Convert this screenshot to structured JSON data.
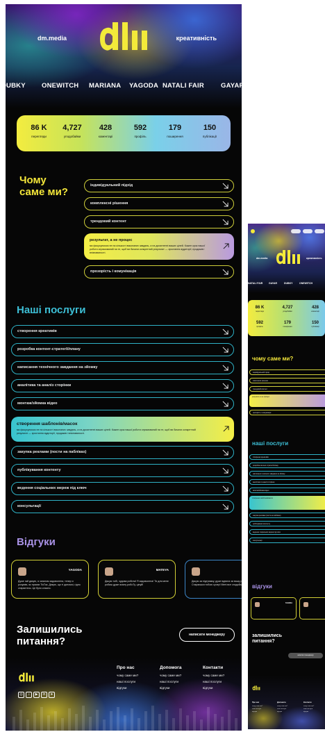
{
  "colors": {
    "background": "#060606",
    "yellow": "#f3e63a",
    "teal": "#3dbfd6",
    "purple": "#a992e6"
  },
  "header": {
    "brand": "dm.media",
    "tagline": "креативність",
    "logo_icon": "dm-logo"
  },
  "marquee": [
    "DUBKY",
    "ONEWITCH",
    "MARIANA",
    "YAGODA",
    "NATALI FAIR",
    "GAYAR"
  ],
  "stats": [
    {
      "value": "86 K",
      "label": "перегляди"
    },
    {
      "value": "4,727",
      "label": "уподобайки"
    },
    {
      "value": "428",
      "label": "коментарі"
    },
    {
      "value": "592",
      "label": "профіль"
    },
    {
      "value": "179",
      "label": "поширення"
    },
    {
      "value": "150",
      "label": "публікації"
    }
  ],
  "why": {
    "title": "Чому\nсаме ми?",
    "items": [
      {
        "label": "індивідуальний підхід"
      },
      {
        "label": "комплексні рішення"
      },
      {
        "label": "трендовий контент"
      },
      {
        "label": "результат, а не процес",
        "desc": "ми фокусуємося не на кількості виконаних завдань, а на досягненні ваших цілей. Кожен крок нашої роботи спрямований на те, щоб ви бачили конкретний результат — зростання аудиторії, продажів і впізнаваності."
      },
      {
        "label": "прозорість і комунікація"
      }
    ]
  },
  "services": {
    "title": "Наші послуги",
    "items": [
      {
        "label": "створення креативів"
      },
      {
        "label": "розробка контент-стратегії/плану"
      },
      {
        "label": "написання технічного завдання на зйомку"
      },
      {
        "label": "аналітика та аналіз сторінки"
      },
      {
        "label": "монтаж/зйомка відео"
      },
      {
        "label": "створення шаблонів/масок",
        "desc": "ми фокусуємося не на кількості виконаних завдань, а на досягненні ваших цілей. Кожен крок нашої роботи спрямований на те, щоб ви бачили конкретний результат — зростання аудиторії, продажів і впізнаваності."
      },
      {
        "label": "закупка реклами (пости на пабліках)"
      },
      {
        "label": "публікування контенту"
      },
      {
        "label": "ведення соціальних мереж під ключ"
      },
      {
        "label": "консультації"
      }
    ]
  },
  "reviews": {
    "title": "Відгуки",
    "items": [
      {
        "name": "YAGODA",
        "text": "Дуже raй дякую, я загалом задоволена, тепер я розумію, як прахає ТікТок. Дякую, що ті допомоі, гідно стараєтесь. Це було класно."
      },
      {
        "name": "MATEYA",
        "text": "Дякую тобі, чудова робота! Я задоволена! Ти для мене робиш дуже якісну робоТу, цінуй!"
      },
      {
        "name": "",
        "text": "Дякую за підтримку, дуже вдячна за вашу роботу. Стараєшся тобою сучер! Мені все сподобалось."
      }
    ]
  },
  "questions": {
    "title": "Залишились\nпитання?",
    "button": "написати менеджеру"
  },
  "footer": {
    "socials": [
      "instagram-icon",
      "tiktok-icon",
      "youtube-icon",
      "linkedin-icon",
      "telegram-icon"
    ],
    "columns": [
      {
        "heading": "Про нас",
        "links": [
          "чому саме ми?",
          "наші послуги",
          "відгуки"
        ]
      },
      {
        "heading": "Допомога",
        "links": [
          "чому саме ми?",
          "наші послуги",
          "відгуки"
        ]
      },
      {
        "heading": "Контакти",
        "links": [
          "чому саме ми?",
          "наші послуги",
          "відгуки"
        ]
      }
    ]
  },
  "mobile": {
    "brand": "dm.media",
    "tagline": "креативність",
    "marquee": [
      "NATALI FAIR",
      "GAYAR",
      "DUBKY",
      "ONEWITCH"
    ],
    "why_title": "чому саме ми?",
    "services_title": "наші послуги",
    "reviews_title": "відгуки",
    "questions_title": "залишились\nпитання?",
    "button": "написати менеджеру"
  }
}
